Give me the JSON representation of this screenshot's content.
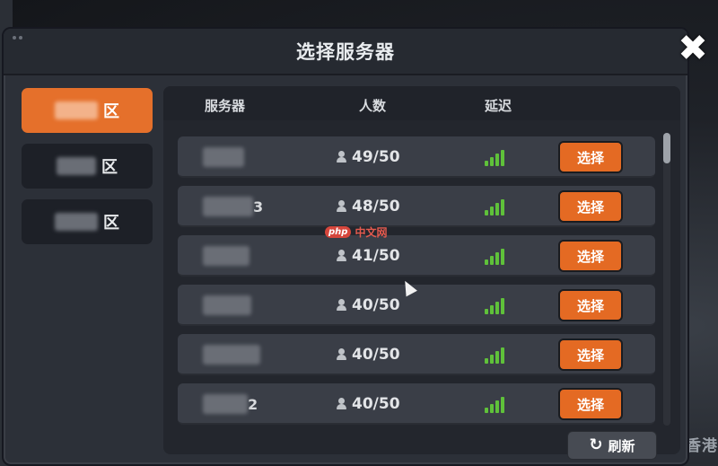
{
  "dialog": {
    "title": "选择服务器",
    "close_symbol": "✖",
    "close_icon": "close-icon"
  },
  "regions": [
    {
      "label": "区",
      "active": true
    },
    {
      "label": "区",
      "active": false
    },
    {
      "label": "区",
      "active": false
    }
  ],
  "table": {
    "headers": {
      "name": "服务器",
      "count": "人数",
      "ping": "延迟"
    }
  },
  "servers": [
    {
      "name_suffix": "",
      "count": "49/50",
      "signal": "strong",
      "action": "选择"
    },
    {
      "name_suffix": "3",
      "count": "48/50",
      "signal": "strong",
      "action": "选择"
    },
    {
      "name_suffix": "",
      "count": "41/50",
      "signal": "strong",
      "action": "选择"
    },
    {
      "name_suffix": "",
      "count": "40/50",
      "signal": "strong",
      "action": "选择"
    },
    {
      "name_suffix": "",
      "count": "40/50",
      "signal": "strong",
      "action": "选择"
    },
    {
      "name_suffix": "2",
      "count": "40/50",
      "signal": "strong",
      "action": "选择"
    }
  ],
  "refresh": {
    "label": "刷新",
    "icon": "refresh-icon"
  },
  "watermark": {
    "badge": "php",
    "text": "中文网"
  },
  "background_text": "香港",
  "colors": {
    "accent": "#e5702b",
    "signal": "#5fc13a",
    "panel": "#2c3038"
  }
}
